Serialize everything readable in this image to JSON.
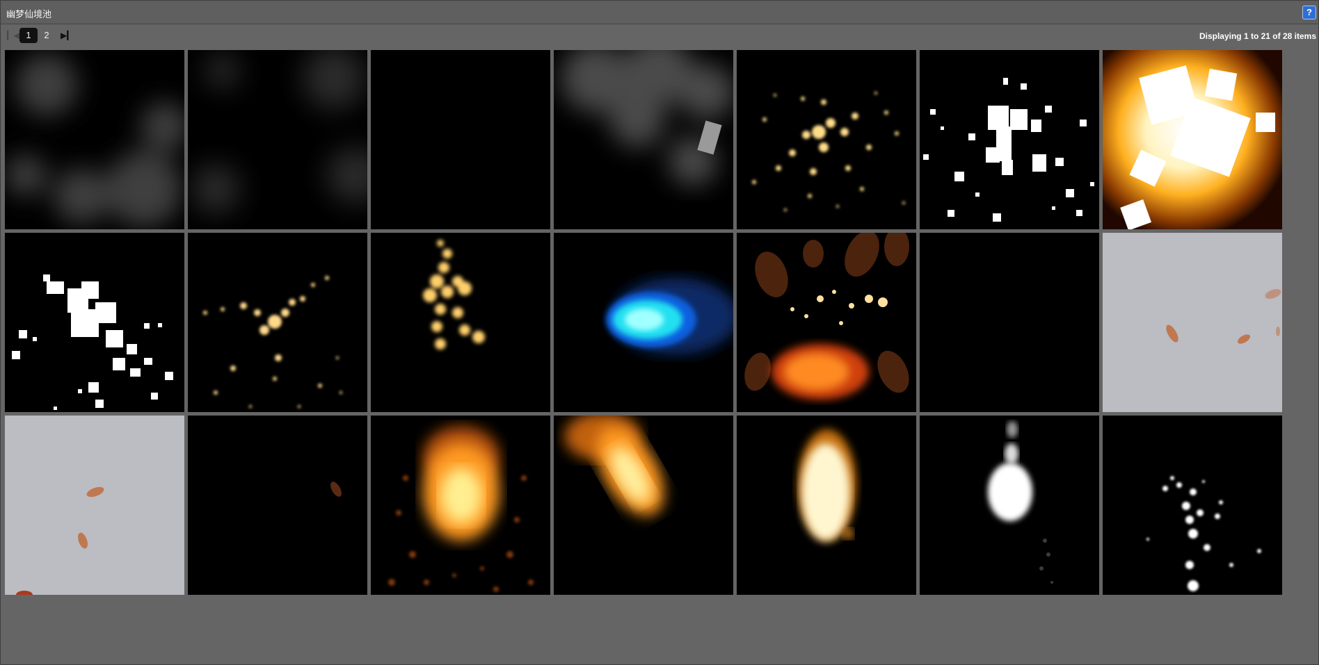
{
  "window": {
    "title": "幽梦仙境池",
    "help_icon": "help-icon",
    "help_label": "?"
  },
  "pager": {
    "first_icon": "first-page-icon",
    "last_icon": "last-page-icon",
    "pages": [
      "1",
      "2"
    ],
    "current_page": "1",
    "display_info": "Displaying 1 to 21 of 28 items"
  },
  "gallery": {
    "items": [
      {
        "name": "smoke-gray"
      },
      {
        "name": "smoke-dark"
      },
      {
        "name": "empty-black"
      },
      {
        "name": "smoke-with-card"
      },
      {
        "name": "gold-sparks-burst"
      },
      {
        "name": "white-square-particles"
      },
      {
        "name": "fire-explosion-squares"
      },
      {
        "name": "white-square-scatter"
      },
      {
        "name": "gold-sparks-spread"
      },
      {
        "name": "gold-flame-trail"
      },
      {
        "name": "cyan-energy-ball"
      },
      {
        "name": "autumn-leaves-fire"
      },
      {
        "name": "empty-black"
      },
      {
        "name": "falling-leaves-light"
      },
      {
        "name": "falling-leaves-light"
      },
      {
        "name": "falling-leaf-dark"
      },
      {
        "name": "fireball-orange"
      },
      {
        "name": "fire-comet"
      },
      {
        "name": "white-flame"
      },
      {
        "name": "white-glow-drop"
      },
      {
        "name": "white-bubbles"
      }
    ]
  }
}
